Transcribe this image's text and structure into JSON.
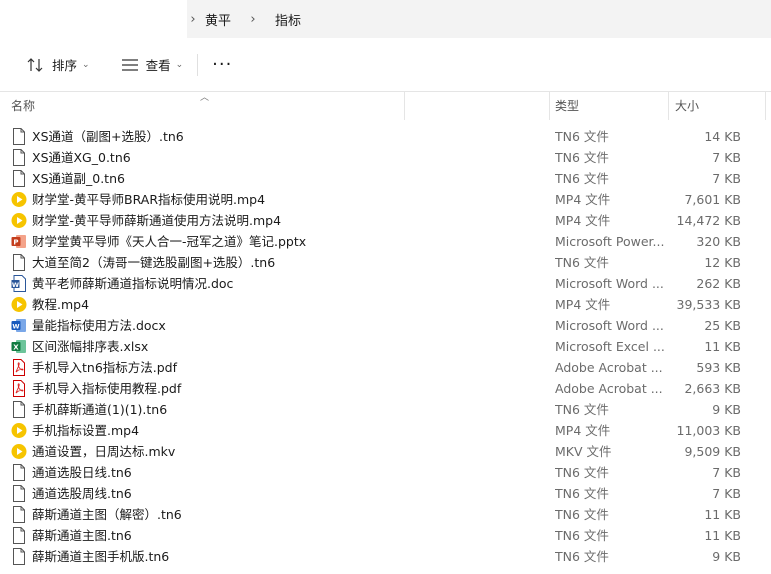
{
  "breadcrumb": [
    "黄平",
    "指标"
  ],
  "toolbar": {
    "sort_label": "排序",
    "view_label": "查看",
    "more_label": "···"
  },
  "columns": {
    "name": "名称",
    "type": "类型",
    "size": "大小"
  },
  "files": [
    {
      "name": "XS通道（副图+选股）.tn6",
      "type": "TN6 文件",
      "size": "14 KB",
      "icon": "file-icon"
    },
    {
      "name": "XS通道XG_0.tn6",
      "type": "TN6 文件",
      "size": "7 KB",
      "icon": "file-icon"
    },
    {
      "name": "XS通道副_0.tn6",
      "type": "TN6 文件",
      "size": "7 KB",
      "icon": "file-icon"
    },
    {
      "name": "财学堂-黄平导师BRAR指标使用说明.mp4",
      "type": "MP4 文件",
      "size": "7,601 KB",
      "icon": "video-icon"
    },
    {
      "name": "财学堂-黄平导师薛斯通道使用方法说明.mp4",
      "type": "MP4 文件",
      "size": "14,472 KB",
      "icon": "video-icon"
    },
    {
      "name": "财学堂黄平导师《天人合一-冠军之道》笔记.pptx",
      "type": "Microsoft Power...",
      "size": "320 KB",
      "icon": "powerpoint-icon"
    },
    {
      "name": "大道至简2（涛哥一键选股副图+选股）.tn6",
      "type": "TN6 文件",
      "size": "12 KB",
      "icon": "file-icon"
    },
    {
      "name": "黄平老师薛斯通道指标说明情况.doc",
      "type": "Microsoft Word ...",
      "size": "262 KB",
      "icon": "word-doc-icon"
    },
    {
      "name": "教程.mp4",
      "type": "MP4 文件",
      "size": "39,533 KB",
      "icon": "video-icon"
    },
    {
      "name": "量能指标使用方法.docx",
      "type": "Microsoft Word ...",
      "size": "25 KB",
      "icon": "word-icon"
    },
    {
      "name": "区间涨幅排序表.xlsx",
      "type": "Microsoft Excel ...",
      "size": "11 KB",
      "icon": "excel-icon"
    },
    {
      "name": "手机导入tn6指标方法.pdf",
      "type": "Adobe Acrobat ...",
      "size": "593 KB",
      "icon": "pdf-icon"
    },
    {
      "name": "手机导入指标使用教程.pdf",
      "type": "Adobe Acrobat ...",
      "size": "2,663 KB",
      "icon": "pdf-icon"
    },
    {
      "name": "手机薛斯通道(1)(1).tn6",
      "type": "TN6 文件",
      "size": "9 KB",
      "icon": "file-icon"
    },
    {
      "name": "手机指标设置.mp4",
      "type": "MP4 文件",
      "size": "11,003 KB",
      "icon": "video-icon"
    },
    {
      "name": "通道设置，日周达标.mkv",
      "type": "MKV 文件",
      "size": "9,509 KB",
      "icon": "video-icon"
    },
    {
      "name": "通道选股日线.tn6",
      "type": "TN6 文件",
      "size": "7 KB",
      "icon": "file-icon"
    },
    {
      "name": "通道选股周线.tn6",
      "type": "TN6 文件",
      "size": "7 KB",
      "icon": "file-icon"
    },
    {
      "name": "薛斯通道主图（解密）.tn6",
      "type": "TN6 文件",
      "size": "11 KB",
      "icon": "file-icon"
    },
    {
      "name": "薛斯通道主图.tn6",
      "type": "TN6 文件",
      "size": "11 KB",
      "icon": "file-icon"
    },
    {
      "name": "薛斯通道主图手机版.tn6",
      "type": "TN6 文件",
      "size": "9 KB",
      "icon": "file-icon"
    }
  ]
}
